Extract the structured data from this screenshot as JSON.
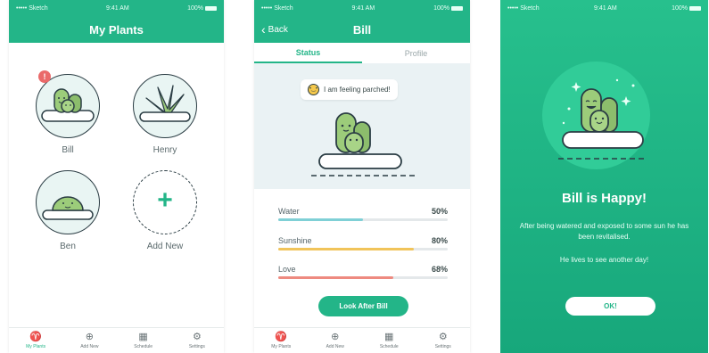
{
  "status_bar": {
    "carrier": "••••• Sketch",
    "time": "9:41 AM",
    "battery": "100%"
  },
  "screen1": {
    "title": "My Plants",
    "plants": [
      {
        "name": "Bill",
        "alert": "!"
      },
      {
        "name": "Henry"
      },
      {
        "name": "Ben"
      },
      {
        "name": "Add New",
        "plus": "+"
      }
    ]
  },
  "screen2": {
    "back_label": "Back",
    "title": "Bill",
    "tabs": [
      "Status",
      "Profile"
    ],
    "speech": "I am feeling parched!",
    "meters": [
      {
        "label": "Water",
        "value": "50%",
        "fraction": 0.5,
        "color": "#7fd0d6"
      },
      {
        "label": "Sunshine",
        "value": "80%",
        "fraction": 0.8,
        "color": "#f1c45a"
      },
      {
        "label": "Love",
        "value": "68%",
        "fraction": 0.68,
        "color": "#ee8a80"
      }
    ],
    "cta": "Look After Bill"
  },
  "screen3": {
    "title": "Bill is Happy!",
    "message": "After being watered and exposed to some sun he has been revitalised.",
    "submessage": "He lives to see another day!",
    "ok": "OK!"
  },
  "tabbar": [
    {
      "label": "My Plants",
      "icon": "plant-icon",
      "glyph": "♈"
    },
    {
      "label": "Add New",
      "icon": "add-circle-icon",
      "glyph": "⊕"
    },
    {
      "label": "Schedule",
      "icon": "calendar-icon",
      "glyph": "▦"
    },
    {
      "label": "Settings",
      "icon": "gear-icon",
      "glyph": "⚙"
    }
  ],
  "colors": {
    "brand": "#23b588",
    "dark": "#2b3d44",
    "cactus": "#9ccc7a"
  }
}
